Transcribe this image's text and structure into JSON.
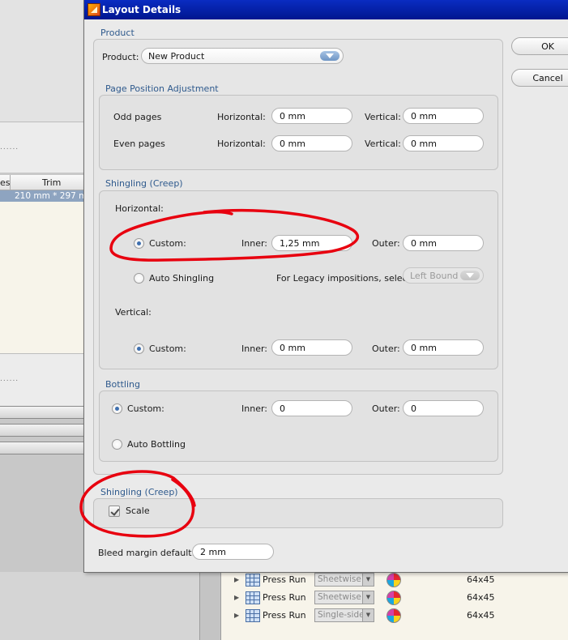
{
  "dialog": {
    "title": "Layout Details",
    "ok_label": "OK",
    "cancel_label": "Cancel",
    "product_group": {
      "heading": "Product",
      "product_label": "Product:",
      "product_value": "New Product"
    },
    "page_position": {
      "heading": "Page Position Adjustment",
      "odd_label": "Odd pages",
      "even_label": "Even pages",
      "horizontal_label": "Horizontal:",
      "vertical_label": "Vertical:",
      "odd_horizontal": "0 mm",
      "odd_vertical": "0 mm",
      "even_horizontal": "0 mm",
      "even_vertical": "0 mm"
    },
    "shingling": {
      "heading": "Shingling (Creep)",
      "horizontal_label": "Horizontal:",
      "vertical_label": "Vertical:",
      "custom_label": "Custom:",
      "inner_label": "Inner:",
      "outer_label": "Outer:",
      "h_inner": "1,25 mm",
      "h_outer": "0 mm",
      "auto_label": "Auto Shingling",
      "legacy_label": "For Legacy impositions, select:",
      "legacy_value": "Left Bound",
      "v_inner": "0 mm",
      "v_outer": "0 mm"
    },
    "bottling": {
      "heading": "Bottling",
      "custom_label": "Custom:",
      "inner_label": "Inner:",
      "outer_label": "Outer:",
      "inner": "0",
      "outer": "0",
      "auto_label": "Auto Bottling"
    },
    "shingling_scale": {
      "heading": "Shingling (Creep)",
      "scale_label": "Scale"
    },
    "bleed": {
      "label": "Bleed margin default:",
      "value": "2 mm"
    }
  },
  "background": {
    "column_partial": "es",
    "column_trim": "Trim",
    "selected_trim": "210 mm * 297 m",
    "dots": "......",
    "press_runs": [
      {
        "name": "Press Run",
        "mode": "Sheetwise",
        "size": "64x45"
      },
      {
        "name": "Press Run",
        "mode": "Sheetwise",
        "size": "64x45"
      },
      {
        "name": "Press Run",
        "mode": "Single-side",
        "size": "64x45"
      }
    ]
  },
  "annotation_color": "#e8000f"
}
